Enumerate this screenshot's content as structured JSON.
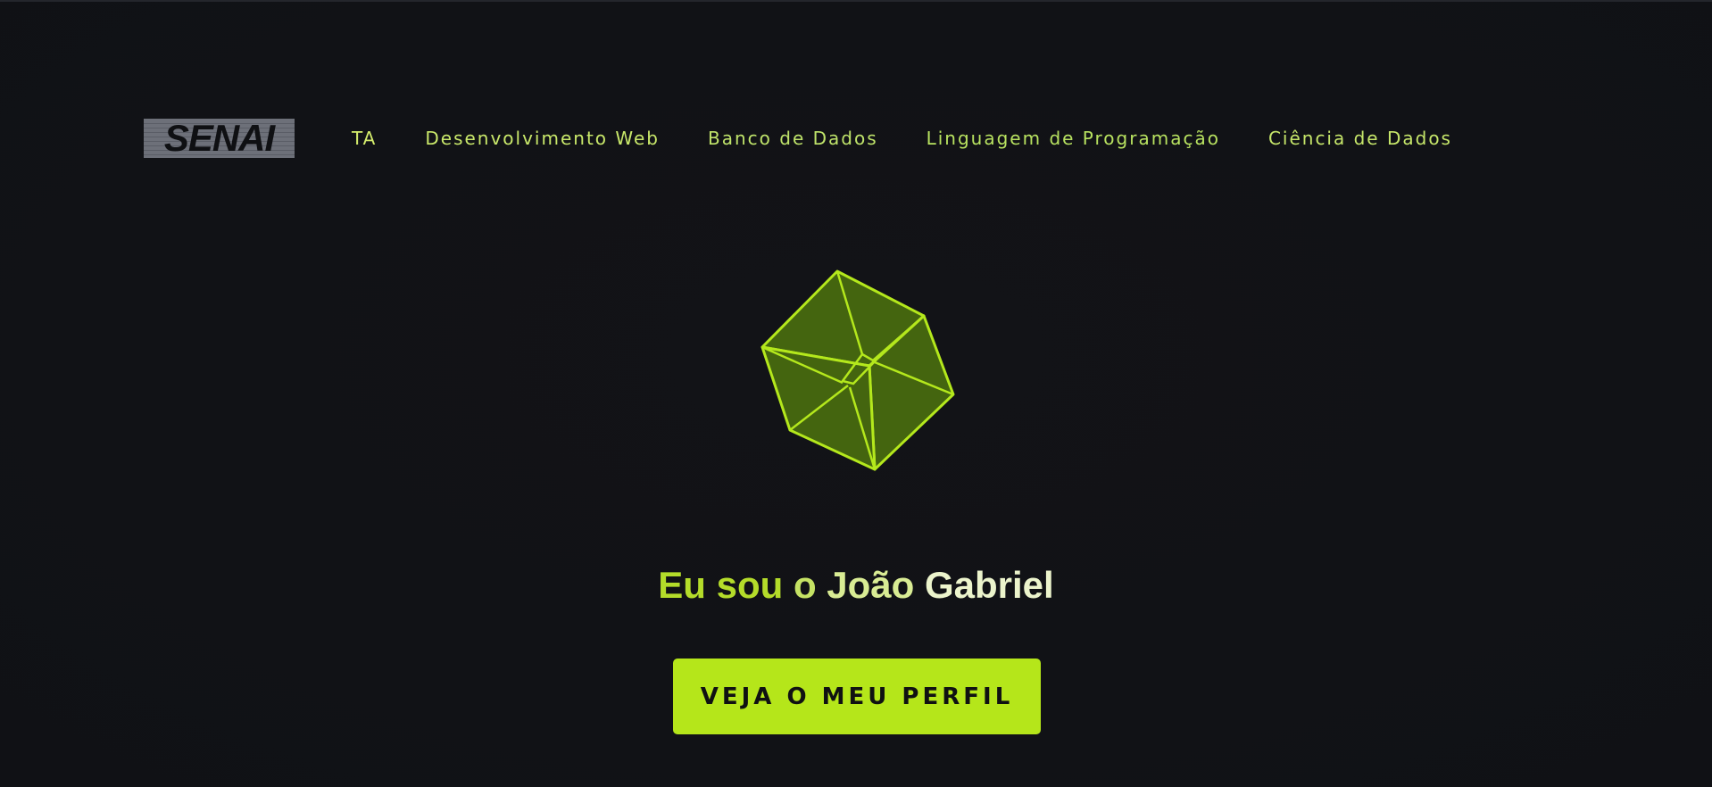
{
  "logo": {
    "text": "SENAI"
  },
  "nav": {
    "items": [
      {
        "label": "TA"
      },
      {
        "label": "Desenvolvimento Web"
      },
      {
        "label": "Banco de Dados"
      },
      {
        "label": "Linguagem de Programação"
      },
      {
        "label": "Ciência de Dados"
      }
    ]
  },
  "hero": {
    "icon": "cube-icon",
    "title_words": [
      "Eu sou",
      "o",
      "João",
      "Gabriel"
    ],
    "cta_label": "VEJA O MEU PERFIL"
  },
  "colors": {
    "background": "#111216",
    "accent": "#b5e61a",
    "cube_fill": "#44650f",
    "cube_edge": "#b4e81c"
  }
}
